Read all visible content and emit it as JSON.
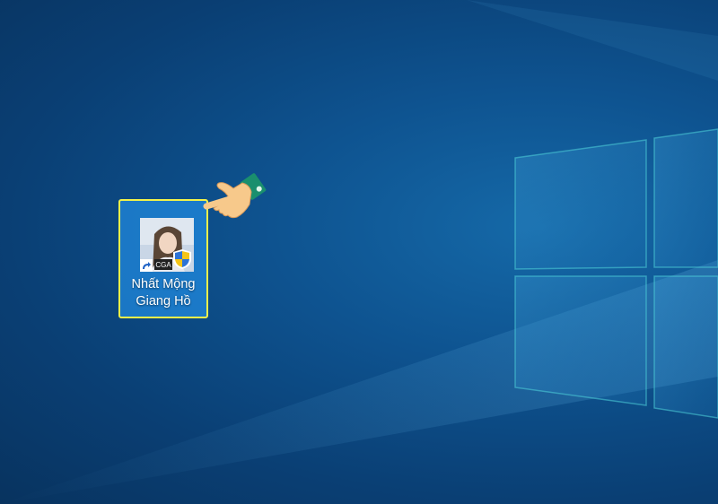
{
  "desktop": {
    "shortcut": {
      "label_line1": "Nhất Mộng",
      "label_line2": "Giang Hồ",
      "badge_text": "CGA",
      "icon": "game-app-icon",
      "overlay_icons": [
        "shortcut-arrow-icon",
        "uac-shield-icon"
      ],
      "selected": true
    },
    "pointer": "pointing-hand-icon"
  },
  "colors": {
    "background": "#0b4a86",
    "selection_fill": "#28a0ff",
    "selection_border": "#f2f24a",
    "label_text": "#ffffff",
    "pointer_cuff": "#1a8f6e",
    "pointer_skin": "#f7c98b"
  }
}
